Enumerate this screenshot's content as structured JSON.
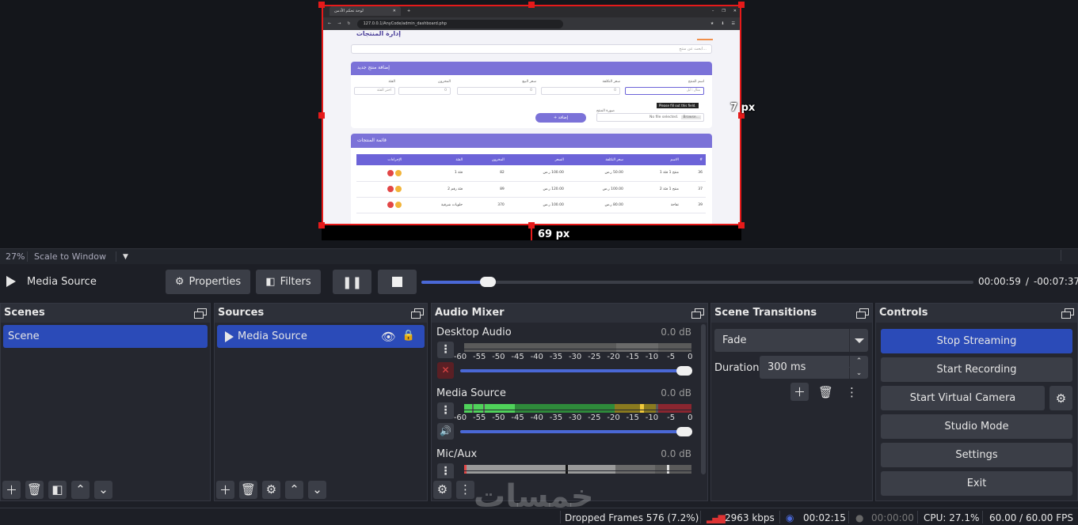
{
  "preview": {
    "browser": {
      "tab_title": "لوحة تحكم الأدمن",
      "url": "127.0.0.1/AnyCode/admin_dashboard.php",
      "page_title": "إدارة المنتجات",
      "search_placeholder": "ابحث عن منتج...",
      "add_card": {
        "title": "إضافة منتج جديد",
        "fields": [
          {
            "label": "اسم المنتج",
            "placeholder": "مثال: أبل"
          },
          {
            "label": "سعر التكلفة",
            "placeholder": "0"
          },
          {
            "label": "سعر البيع",
            "placeholder": "0"
          },
          {
            "label": "المخزون",
            "placeholder": "0"
          },
          {
            "label": "الفئة",
            "placeholder": "اختر الفئة"
          }
        ],
        "image_label": "صورة المنتج",
        "file_button": "Browse...",
        "file_status": "No file selected.",
        "tooltip": "Please fill out this field.",
        "submit": "+ إضافة"
      },
      "list_card": {
        "title": "قائمة المنتجات",
        "columns": [
          "#",
          "الاسم",
          "سعر التكلفة",
          "السعر",
          "المخزون",
          "الفئة",
          "الإجراءات"
        ],
        "rows": [
          [
            "36",
            "منتج 1 فئة 1",
            "50.00 ر.س",
            "100.00 ر.س",
            "82",
            "فئة 1"
          ],
          [
            "37",
            "منتج 1 فئة 2",
            "100.00 ر.س",
            "120.00 ر.س",
            "89",
            "فئة رقم 2"
          ],
          [
            "39",
            "تفاحة",
            "80.00 ر.س",
            "100.00 ر.س",
            "370",
            "حلويات شرقية"
          ]
        ]
      }
    },
    "guide_bottom": "69 px",
    "guide_right": "7 px"
  },
  "zoom": {
    "percent": "27%",
    "mode": "Scale to Window"
  },
  "media": {
    "name": "Media Source",
    "properties": "Properties",
    "filters": "Filters",
    "progress": 0.12,
    "elapsed": "00:00:59",
    "remaining": "-00:07:37",
    "separator": "/"
  },
  "docks": {
    "scenes": {
      "title": "Scenes",
      "items": [
        "Scene"
      ]
    },
    "sources": {
      "title": "Sources",
      "items": [
        "Media Source"
      ]
    },
    "mixer": {
      "title": "Audio Mixer",
      "scale": [
        "-60",
        "-55",
        "-50",
        "-45",
        "-40",
        "-35",
        "-30",
        "-25",
        "-20",
        "-15",
        "-10",
        "-5",
        "0"
      ],
      "channels": [
        {
          "name": "Desktop Audio",
          "db": "0.0 dB",
          "muted": true
        },
        {
          "name": "Media Source",
          "db": "0.0 dB",
          "muted": false
        },
        {
          "name": "Mic/Aux",
          "db": "0.0 dB",
          "muted": false
        }
      ]
    },
    "transitions": {
      "title": "Scene Transitions",
      "selected": "Fade",
      "duration_label": "Duration",
      "duration": "300 ms"
    },
    "controls": {
      "title": "Controls",
      "buttons": [
        "Stop Streaming",
        "Start Recording",
        "Start Virtual Camera",
        "Studio Mode",
        "Settings",
        "Exit"
      ]
    }
  },
  "status": {
    "dropped": "Dropped Frames 576 (7.2%)",
    "bitrate": "2963 kbps",
    "stream_time": "00:02:15",
    "rec_time": "00:00:00",
    "cpu": "CPU: 27.1%",
    "fps": "60.00 / 60.00 FPS"
  },
  "watermark": "خمسات",
  "colors": {
    "accent": "#2b4bb8",
    "selection": "#e61a1a",
    "panel": "#25272f"
  }
}
